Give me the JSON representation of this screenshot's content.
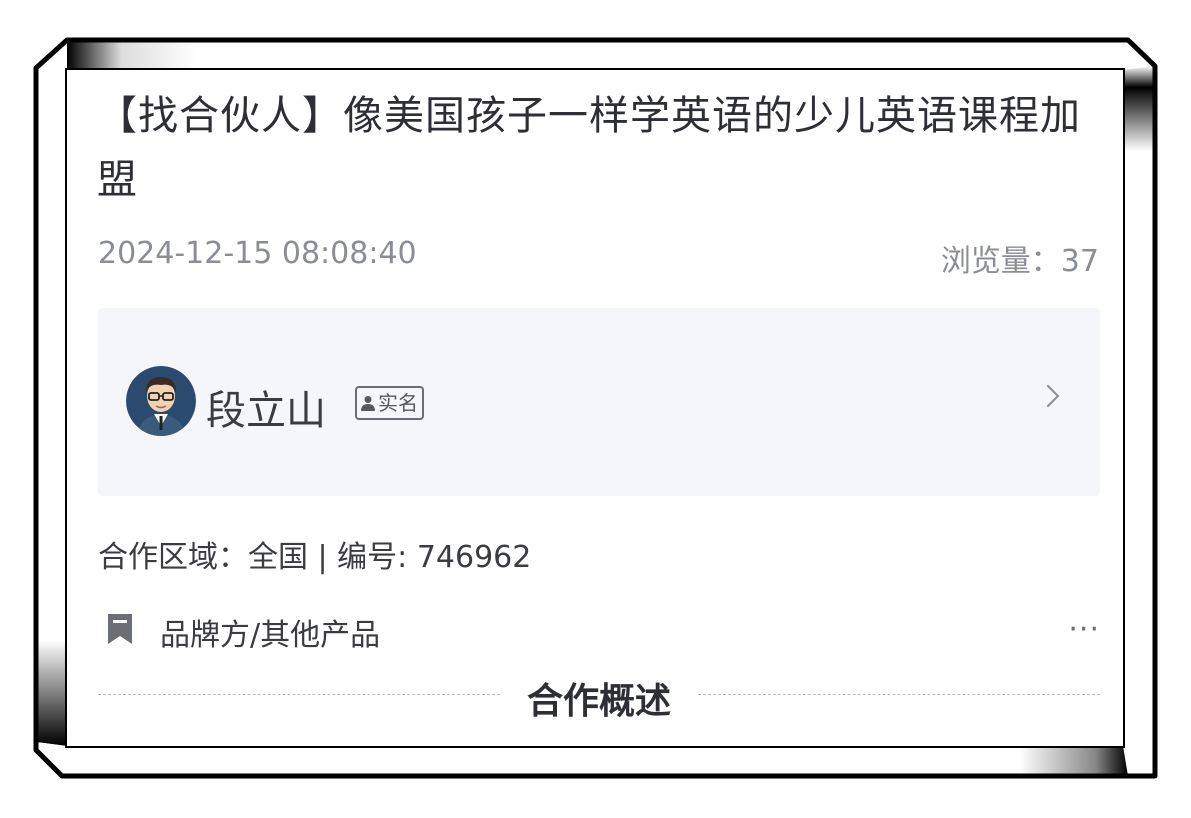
{
  "post": {
    "title": "【找合伙人】像美国孩子一样学英语的少儿英语课程加盟",
    "date": "2024-12-15 08:08:40",
    "views": "浏览量：37"
  },
  "author": {
    "name": "段立山",
    "badge": "实名"
  },
  "info": "合作区域：全国 | 编号: 746962",
  "category": {
    "label": "品牌方/其他产品",
    "more": "···"
  },
  "section": {
    "title": "合作概述"
  },
  "icons": {
    "avatar": "avatar-cartoon-man",
    "badge": "person-icon",
    "chevron": "chevron-right-icon",
    "category": "bookmark-icon",
    "more": "more-dots-icon"
  },
  "colors": {
    "text_primary": "#2d2f35",
    "text_muted": "#8a8d96",
    "card_bg": "#f5f6f9"
  }
}
